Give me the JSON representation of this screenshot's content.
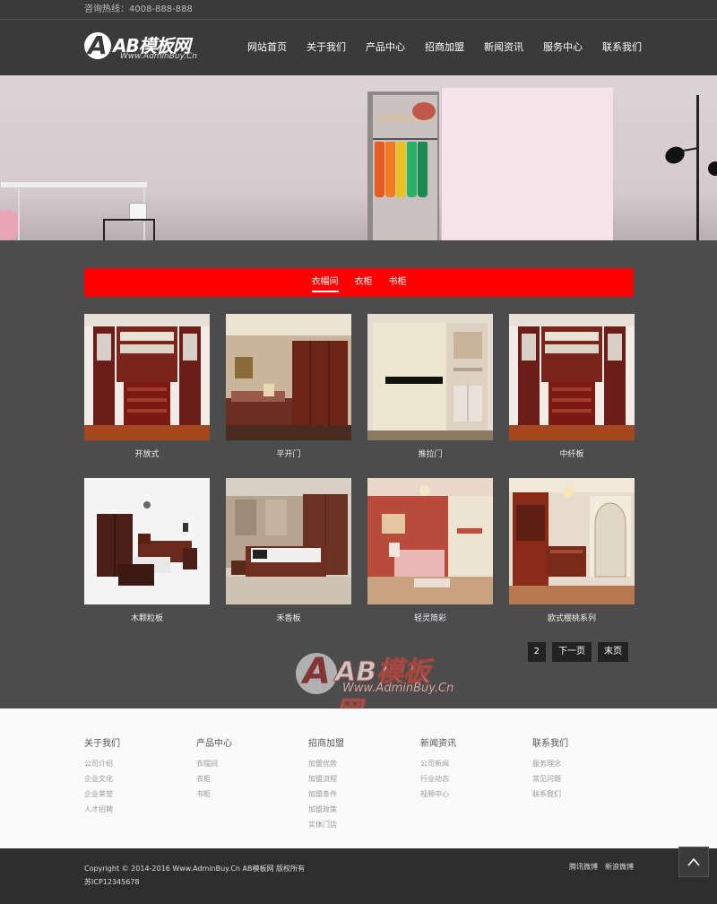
{
  "topbar": {
    "hotline": "咨询热线：4008-888-888"
  },
  "logo": {
    "text": "AB模板网",
    "subtext": "Www.AdminBuy.Cn"
  },
  "nav": [
    "网站首页",
    "关于我们",
    "产品中心",
    "招商加盟",
    "新闻资讯",
    "服务中心",
    "联系我们"
  ],
  "tabs": [
    {
      "label": "衣帽间",
      "active": true
    },
    {
      "label": "衣柜",
      "active": false
    },
    {
      "label": "书柜",
      "active": false
    }
  ],
  "products": [
    {
      "caption": "开放式"
    },
    {
      "caption": "平开门"
    },
    {
      "caption": "推拉门"
    },
    {
      "caption": "中纤板"
    },
    {
      "caption": "木颗粒板"
    },
    {
      "caption": "禾香板"
    },
    {
      "caption": "轻灵简彩"
    },
    {
      "caption": "欧式樱桃系列"
    }
  ],
  "watermark": {
    "text": "AB模板网",
    "sub": "Www.AdminBuy.Cn"
  },
  "pager": {
    "page": "2",
    "next": "下一页",
    "last": "末页"
  },
  "footer": {
    "cols": [
      {
        "title": "关于我们",
        "links": [
          "公司介绍",
          "企业文化",
          "企业荣誉",
          "人才招聘"
        ]
      },
      {
        "title": "产品中心",
        "links": [
          "衣帽间",
          "衣柜",
          "书柜"
        ]
      },
      {
        "title": "招商加盟",
        "links": [
          "加盟优势",
          "加盟流程",
          "加盟条件",
          "加盟政策",
          "实体门店"
        ]
      },
      {
        "title": "新闻资讯",
        "links": [
          "公司新闻",
          "行业动态",
          "视频中心"
        ]
      },
      {
        "title": "联系我们",
        "links": [
          "服务理念",
          "常见问题",
          "联系我们"
        ]
      }
    ]
  },
  "bottom": {
    "copyright": "Copyright © 2014-2016 Www.AdminBuy.Cn AB模板网 版权所有",
    "icp": "苏ICP12345678",
    "social": [
      "腾讯微博",
      "新浪微博"
    ]
  },
  "colors": {
    "accent": "#ff0000",
    "header_bg": "#3a3a3a",
    "body_bg": "#4c4c4c"
  },
  "icons": {
    "back_to_top": "chevron-up-icon"
  }
}
